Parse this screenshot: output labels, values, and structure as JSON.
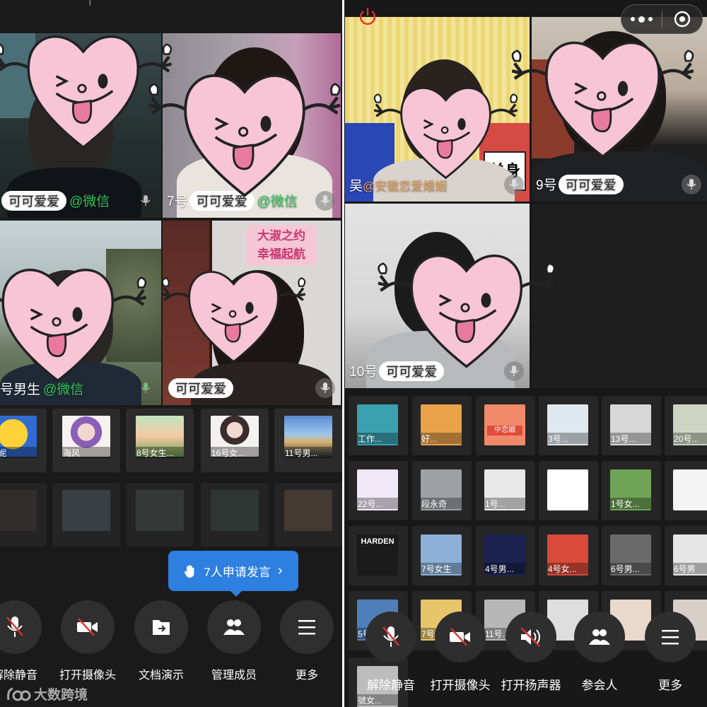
{
  "left": {
    "top_strip_text": "· · ·  |  · · ·",
    "videos": [
      {
        "name_prefix": "",
        "tag": "可可爱爱",
        "suffix": "@微信"
      },
      {
        "name_prefix": "7号",
        "tag": "可可爱爱",
        "suffix": "@微信"
      },
      {
        "name_prefix": "号男生",
        "tag": "",
        "suffix": "@微信"
      },
      {
        "name_prefix": "",
        "tag": "可可爱爱",
        "suffix": ""
      }
    ],
    "banner_sign": {
      "line1": "大淑之约",
      "line2": "幸福起航"
    },
    "thumbs_row1": [
      "雅妮",
      "海风",
      "8号女生...",
      "16号女...",
      "11号男..."
    ],
    "thumbs_row2": [
      "",
      "",
      "",
      "",
      ""
    ],
    "raise_hand": {
      "label": "7人申请发言",
      "chevron": "›"
    },
    "controls": [
      "解除静音",
      "打开摄像头",
      "文档演示",
      "管理成员",
      "更多"
    ],
    "watermark": "大数跨境"
  },
  "right": {
    "videos": [
      {
        "name_prefix": "吴",
        "tag": "",
        "suffix": "@安徽恋爱婚姻"
      },
      {
        "name_prefix": "9号",
        "tag": "可可爱爱",
        "suffix": ""
      },
      {
        "name_prefix": "10号",
        "tag": "可可爱爱",
        "suffix": ""
      }
    ],
    "sign_text": "单身",
    "thumbs": [
      [
        "工作...",
        "好...",
        "",
        "3号...",
        "13号...",
        "20号..."
      ],
      [
        "22号...",
        "段永奇",
        "1号...",
        "",
        "1号女...",
        ""
      ],
      [
        "",
        "7号女生",
        "4号男...",
        "4号女...",
        "6号男...",
        "6号男"
      ],
      [
        "5号...",
        "7号...",
        "11号...",
        "",
        "",
        ""
      ]
    ],
    "cd_label": "中恋姻",
    "harden_label": "HARDEN",
    "last_thumb_caption": "號女...",
    "controls": [
      "解除静音",
      "打开摄像头",
      "打开扬声器",
      "参会人",
      "更多"
    ]
  },
  "colors": {
    "heart_pink": "#f7c5d6",
    "wechat_green": "#33c65a",
    "accent_blue": "#2d7fe0",
    "mute_red": "#e03030"
  }
}
